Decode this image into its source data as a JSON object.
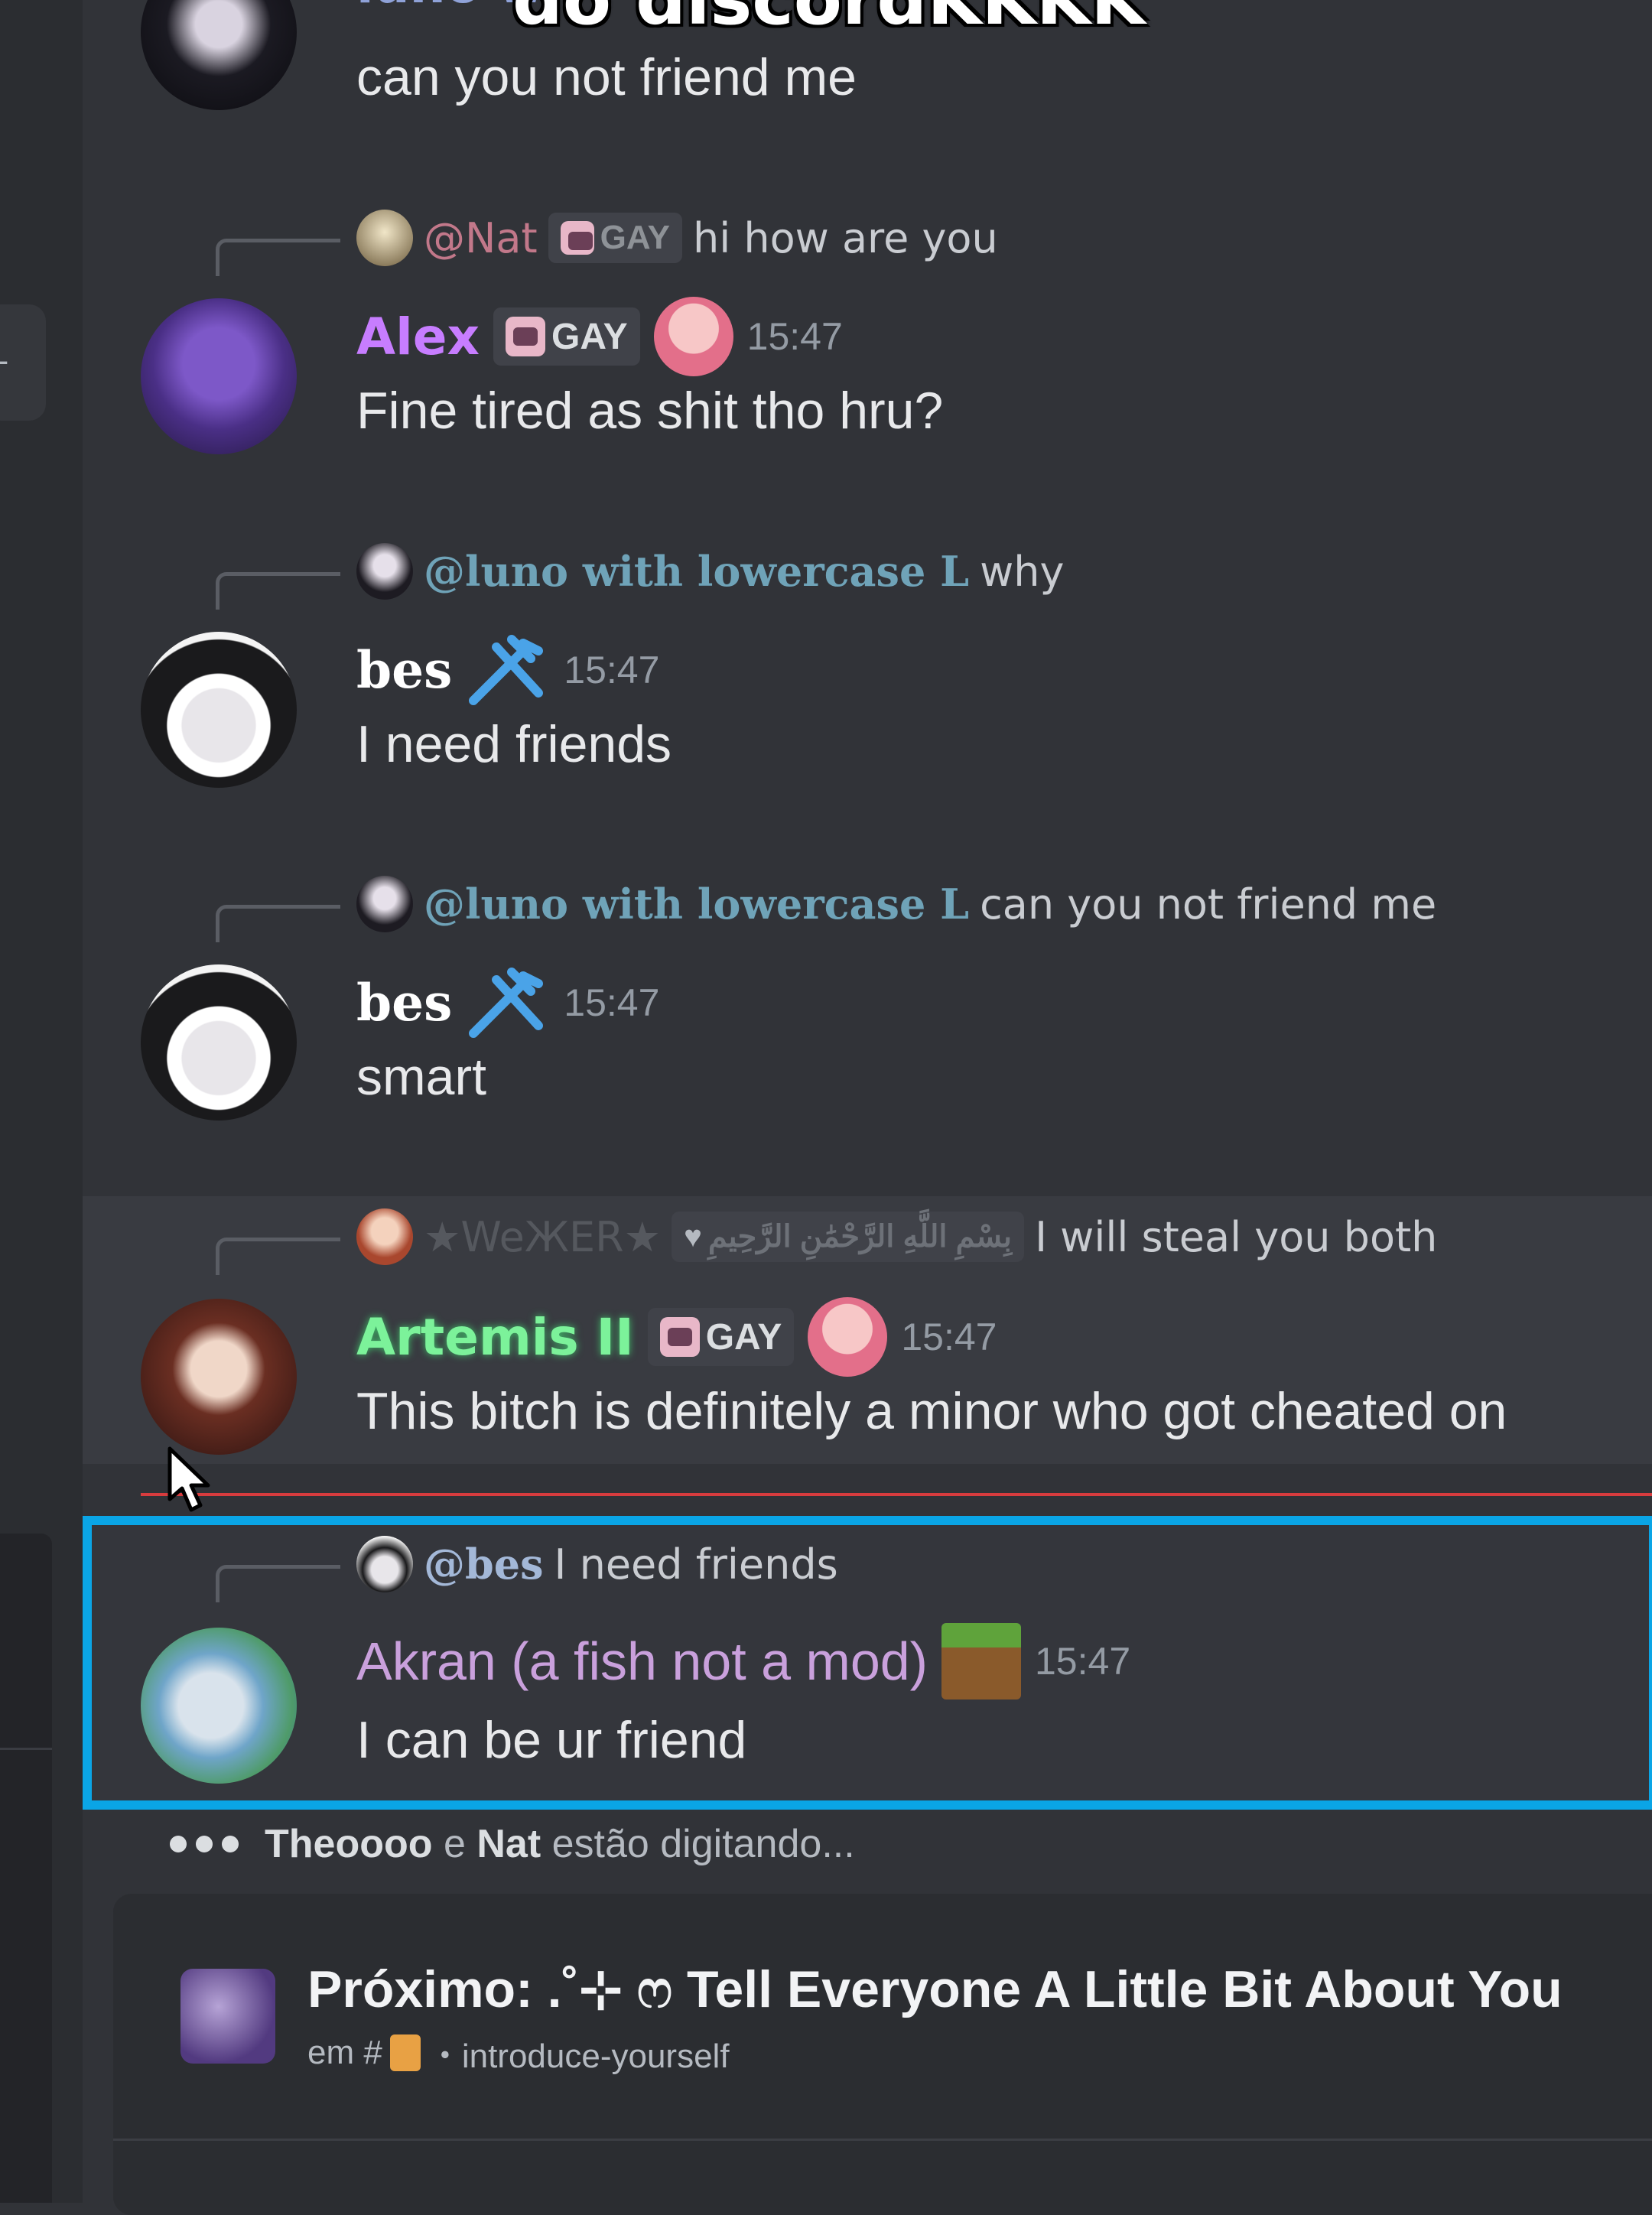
{
  "overlay_caption": "do discordKKKK",
  "rail": {
    "button_symbol": "+"
  },
  "top_message": {
    "body": "can you not friend me",
    "partial_name": "luno w"
  },
  "messages": [
    {
      "reply": {
        "name": "@Nat",
        "tag": "GAY",
        "text": "hi how are you"
      },
      "username": "Alex",
      "name_color": "#c77dff",
      "tag": "GAY",
      "time": "15:47",
      "body": "Fine tired as shit tho hru?"
    },
    {
      "reply": {
        "name": "@luno with lowercase L",
        "text": "why"
      },
      "username": "bes",
      "name_color": "#ffffff",
      "time": "15:47",
      "body": "I need friends"
    },
    {
      "reply": {
        "name": "@luno with lowercase L",
        "text": "can you not friend me"
      },
      "username": "bes",
      "name_color": "#ffffff",
      "time": "15:47",
      "body": "smart"
    },
    {
      "reply": {
        "name": "★WeЖER★",
        "tag": "بِسْمِ اللَّهِ الرَّحْمَٰنِ الرَّحِيمِ",
        "text": "I will steal you both"
      },
      "username": "Artemis II",
      "name_color": "#7cf29a",
      "tag": "GAY",
      "time": "15:47",
      "body": "This bitch is definitely a minor who got cheated on"
    },
    {
      "reply": {
        "name": "@bes",
        "text": "I need friends"
      },
      "username": "Akran (a fish not a mod)",
      "name_color": "#c9a0dc",
      "time": "15:47",
      "body": "I can be ur friend"
    }
  ],
  "typing": {
    "user1": "Theoooo",
    "conj": "e",
    "user2": "Nat",
    "suffix": "estão digitando..."
  },
  "next": {
    "title": "Próximo: .˚⊹ ෆ Tell Everyone A Little Bit About You",
    "prefix": "em #",
    "channel": "・introduce-yourself"
  }
}
